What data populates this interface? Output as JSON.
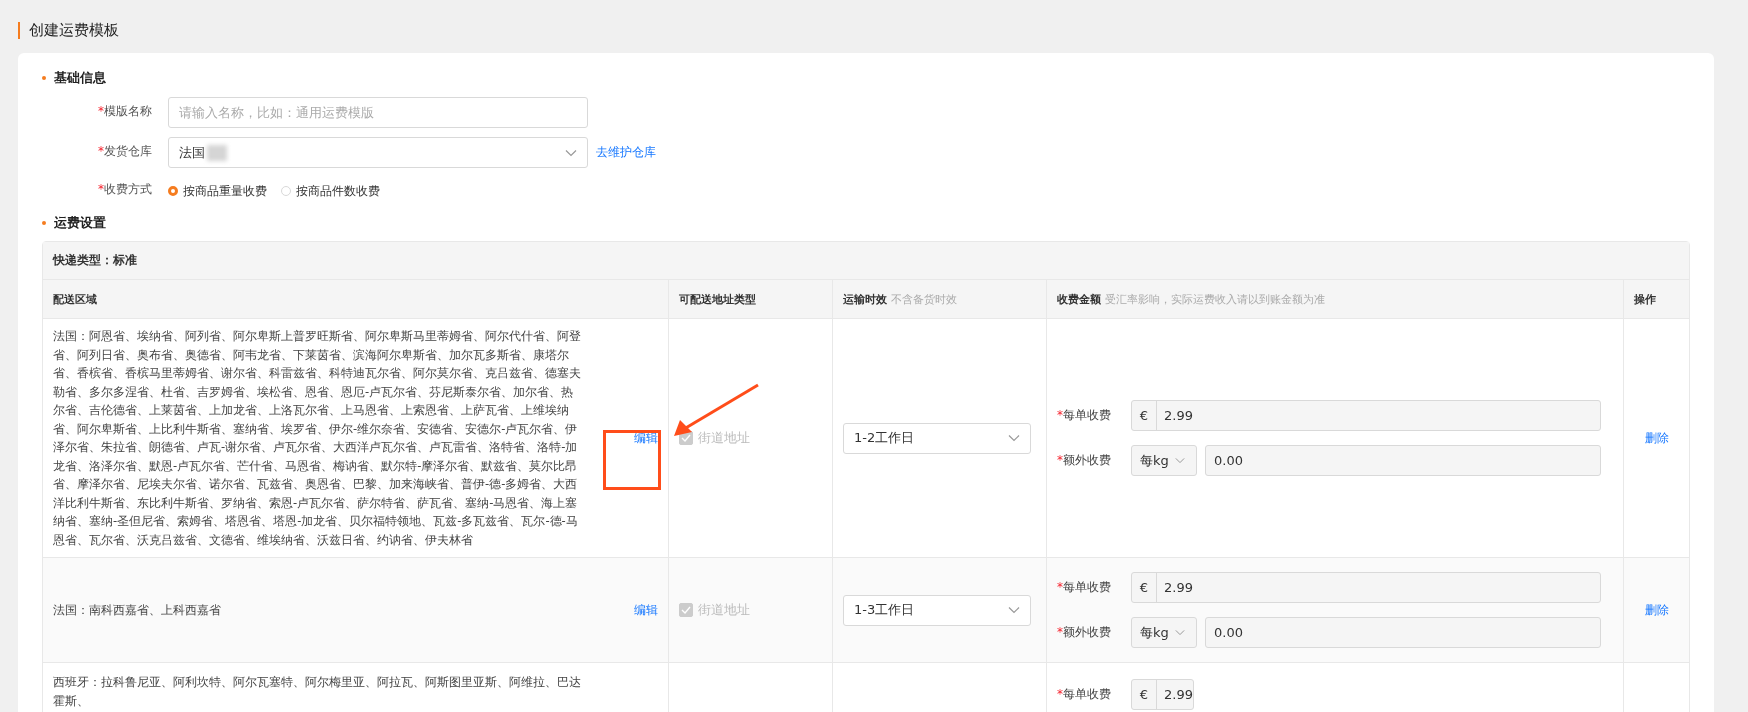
{
  "page_title": "创建运费模板",
  "basic_info": {
    "heading": "基础信息",
    "template_name": {
      "mark": "*",
      "label": "模版名称",
      "placeholder": "请输入名称，比如：通用运费模版"
    },
    "warehouse": {
      "mark": "*",
      "label": "发货仓库",
      "value": "法国",
      "link": "去维护仓库"
    },
    "charge_method": {
      "mark": "*",
      "label": "收费方式",
      "options": [
        {
          "label": "按商品重量收费",
          "selected": true
        },
        {
          "label": "按商品件数收费",
          "selected": false
        }
      ]
    }
  },
  "shipping_settings": {
    "heading": "运费设置",
    "express_type": "快递类型：标准",
    "columns": [
      {
        "title": "配送区域"
      },
      {
        "title": "可配送地址类型"
      },
      {
        "title": "运输时效",
        "note": "不含备货时效"
      },
      {
        "title": "收费金额",
        "note": "受汇率影响，实际运费收入请以到账金额为准"
      },
      {
        "title": "操作"
      }
    ],
    "rows": [
      {
        "region": "法国：阿恩省、埃纳省、阿列省、阿尔卑斯上普罗旺斯省、阿尔卑斯马里蒂姆省、阿尔代什省、阿登省、阿列日省、奥布省、奥德省、阿韦龙省、下莱茵省、滨海阿尔卑斯省、加尔瓦多斯省、康塔尔省、香槟省、香槟马里蒂姆省、谢尔省、科雷兹省、科特迪瓦尔省、阿尔莫尔省、克吕兹省、德塞夫勒省、多尔多涅省、杜省、吉罗姆省、埃松省、恩省、恩厄-卢瓦尔省、芬尼斯泰尔省、加尔省、热尔省、吉伦德省、上莱茵省、上加龙省、上洛瓦尔省、上马恩省、上索恩省、上萨瓦省、上维埃纳省、阿尔卑斯省、上比利牛斯省、塞纳省、埃罗省、伊尔-维尔奈省、安德省、安德尔-卢瓦尔省、伊泽尔省、朱拉省、朗德省、卢瓦-谢尔省、卢瓦尔省、大西洋卢瓦尔省、卢瓦雷省、洛特省、洛特-加龙省、洛泽尔省、默恩-卢瓦尔省、芒什省、马恩省、梅讷省、默尔特-摩泽尔省、默兹省、莫尔比昂省、摩泽尔省、尼埃夫尔省、诺尔省、瓦兹省、奥恩省、巴黎、加来海峡省、普伊-德-多姆省、大西洋比利牛斯省、东比利牛斯省、罗纳省、索恩-卢瓦尔省、萨尔特省、萨瓦省、塞纳-马恩省、海上塞纳省、塞纳-圣但尼省、索姆省、塔恩省、塔恩-加龙省、贝尔福特领地、瓦兹-多瓦兹省、瓦尔-德-马恩省、瓦尔省、沃克吕兹省、文德省、维埃纳省、沃兹日省、约讷省、伊夫林省",
        "edit_link": "编辑",
        "address_type": {
          "label": "街道地址",
          "checked": true,
          "disabled": true
        },
        "delivery_time": "1-2工作日",
        "per_order": {
          "mark": "*",
          "label": "每单收费",
          "currency": "€",
          "value": "2.99"
        },
        "extra": {
          "mark": "*",
          "label": "额外收费",
          "unit": "每kg",
          "value": "0.00"
        },
        "action": "删除"
      },
      {
        "region": "法国：南科西嘉省、上科西嘉省",
        "edit_link": "编辑",
        "address_type": {
          "label": "街道地址",
          "checked": true,
          "disabled": true
        },
        "delivery_time": "1-3工作日",
        "per_order": {
          "mark": "*",
          "label": "每单收费",
          "currency": "€",
          "value": "2.99"
        },
        "extra": {
          "mark": "*",
          "label": "额外收费",
          "unit": "每kg",
          "value": "0.00"
        },
        "action": "删除"
      },
      {
        "region": "西班牙：拉科鲁尼亚、阿利坎特、阿尔瓦塞特、阿尔梅里亚、阿拉瓦、阿斯图里亚斯、阿维拉、巴达霍斯、",
        "per_order": {
          "mark": "*",
          "label": "每单收费",
          "currency": "€",
          "value": "2.99"
        }
      }
    ]
  }
}
